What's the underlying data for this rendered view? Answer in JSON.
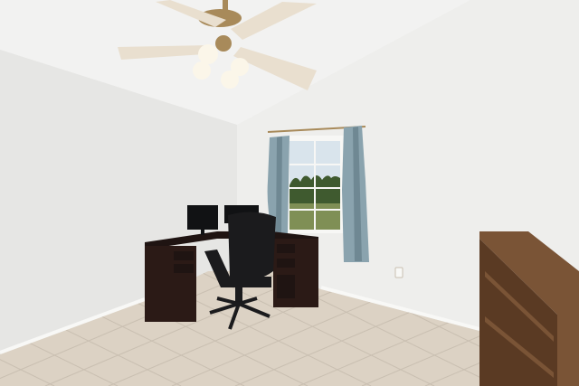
{
  "scene": {
    "subject": "home-office-room",
    "colors": {
      "wall_left": "#e6e6e4",
      "wall_back": "#eeeeec",
      "ceiling": "#f2f2f1",
      "floor_tile": "#dcd2c4",
      "grout": "#c9bfb1",
      "baseboard": "#f8f8f6",
      "desk": "#2b1a16",
      "desk_top": "#1f1412",
      "chair": "#1b1b1d",
      "monitor": "#111214",
      "curtain": "#8aa3ae",
      "curtain_shadow": "#6f8893",
      "window_frame": "#f7f7f5",
      "sky": "#d9e4ec",
      "trees": "#3f5a2f",
      "grass": "#7f8f55",
      "fan_blade": "#e9dfcf",
      "fan_metal": "#a88a5a",
      "fan_globe": "#fbf6e9",
      "bookcase": "#5a3a23",
      "bookcase_top": "#7a5436"
    },
    "icons": [
      "ceiling-fan-icon",
      "office-chair-icon",
      "monitor-icon",
      "window-icon",
      "bookcase-icon",
      "outlet-icon"
    ]
  }
}
